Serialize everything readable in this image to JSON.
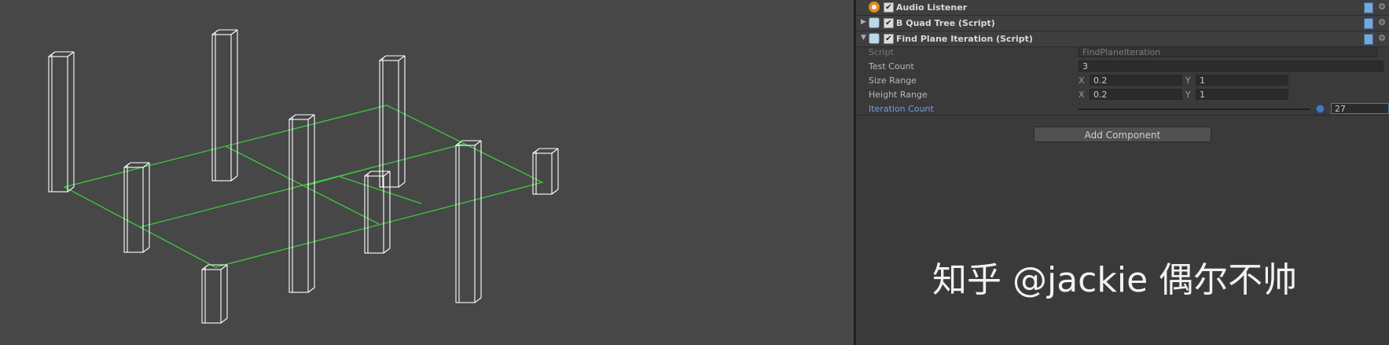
{
  "scene": {
    "colors": {
      "background": "#474747",
      "pillar": "#ffffff",
      "grid": "#3ec83e"
    }
  },
  "inspector": {
    "components": [
      {
        "name": "Audio Listener",
        "icon": "audio-listener-icon",
        "enabled": true,
        "expanded": false
      },
      {
        "name": "B Quad Tree (Script)",
        "icon": "script-icon",
        "enabled": true,
        "expanded": false
      },
      {
        "name": "Find Plane Iteration (Script)",
        "icon": "script-icon",
        "enabled": true,
        "expanded": true
      }
    ],
    "properties": {
      "script": {
        "label": "Script",
        "value": "FindPlaneIteration"
      },
      "test_count": {
        "label": "Test Count",
        "value": "3"
      },
      "size_range": {
        "label": "Size Range",
        "x_label": "X",
        "x": "0.2",
        "y_label": "Y",
        "y": "1"
      },
      "height_range": {
        "label": "Height Range",
        "x_label": "X",
        "x": "0.2",
        "y_label": "Y",
        "y": "1"
      },
      "iteration_count": {
        "label": "Iteration Count",
        "value": "27"
      }
    },
    "add_component_label": "Add Component",
    "check_glyph": "✔",
    "gear_glyph": "⚙",
    "fold_open_glyph": "▼",
    "fold_closed_glyph": "▶"
  },
  "watermark": "知乎 @jackie 偶尔不帅"
}
